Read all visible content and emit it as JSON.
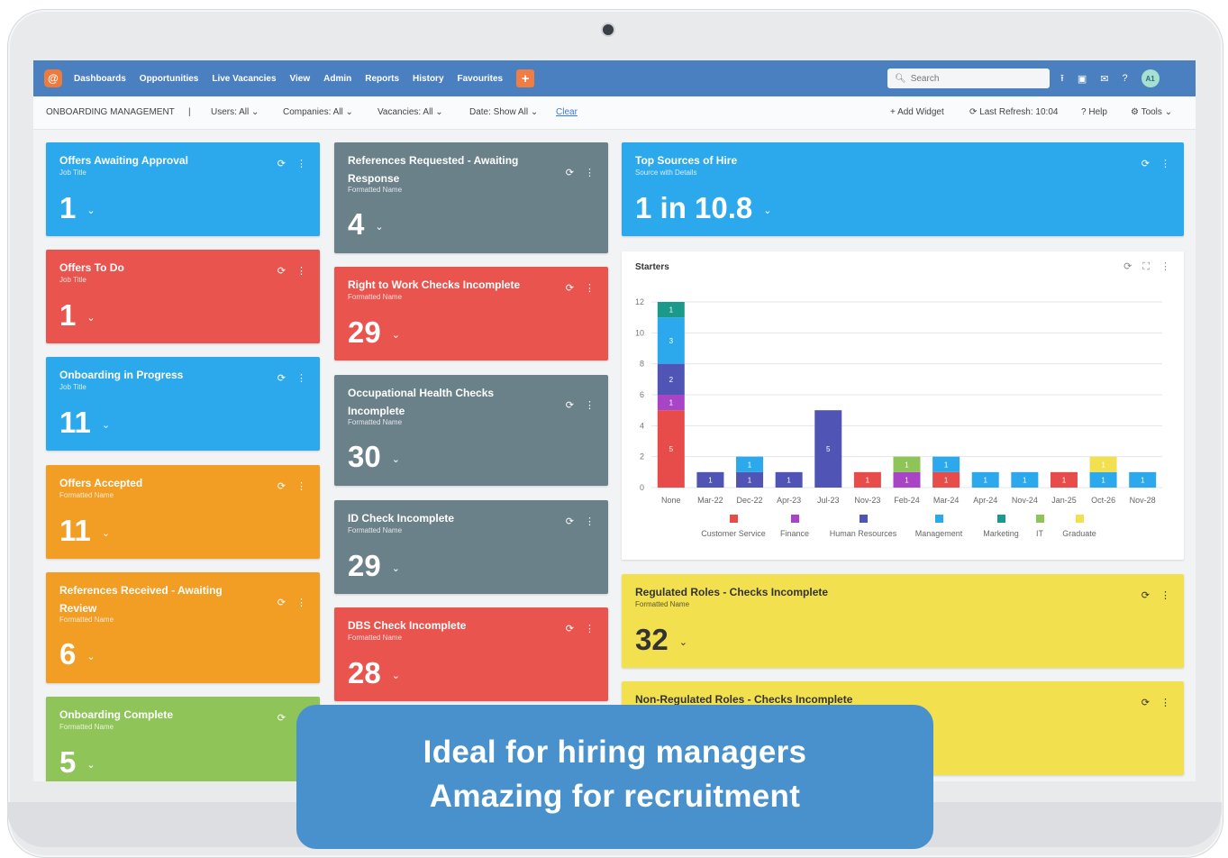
{
  "nav": {
    "logo": "@",
    "items": [
      "Dashboards",
      "Opportunities",
      "Live Vacancies",
      "View",
      "Admin",
      "Reports",
      "History",
      "Favourites"
    ],
    "plus": "+",
    "search_placeholder": "Search",
    "search_icon": "🔍︎",
    "icons": {
      "upload": "⭱",
      "calendar": "▣",
      "mail": "✉",
      "help": "?"
    },
    "avatar": "A1"
  },
  "filters": {
    "section": "ONBOARDING MANAGEMENT",
    "separator": "|",
    "users": "Users: All",
    "companies": "Companies: All",
    "vacancies": "Vacancies: All",
    "date": "Date: Show All",
    "clear": "Clear",
    "add_widget": "Add Widget",
    "last_refresh": "Last Refresh: 10:04",
    "help": "Help",
    "tools": "Tools"
  },
  "tiles": {
    "offers_awaiting": {
      "title": "Offers Awaiting Approval",
      "sub": "Job Title",
      "value": "1"
    },
    "offers_todo": {
      "title": "Offers To Do",
      "sub": "Job Title",
      "value": "1"
    },
    "onboarding_progress": {
      "title": "Onboarding in Progress",
      "sub": "Job Title",
      "value": "11"
    },
    "offers_accepted": {
      "title": "Offers Accepted",
      "sub": "Formatted Name",
      "value": "11"
    },
    "references_received_1": "References Received - Awaiting",
    "references_received_2": "Review",
    "references_received_sub": "Formatted Name",
    "references_received_value": "6",
    "onboarding_complete": {
      "title": "Onboarding Complete",
      "sub": "Formatted Name",
      "value": "5"
    },
    "references_requested_1": "References Requested - Awaiting",
    "references_requested_2": "Response",
    "references_requested_sub": "Formatted Name",
    "references_requested_value": "4",
    "right_to_work": {
      "title": "Right to Work Checks Incomplete",
      "sub": "Formatted Name",
      "value": "29"
    },
    "occupational_1": "Occupational Health Checks",
    "occupational_2": "Incomplete",
    "occupational_sub": "Formatted Name",
    "occupational_value": "30",
    "id_check": {
      "title": "ID Check Incomplete",
      "sub": "Formatted Name",
      "value": "29"
    },
    "dbs_check": {
      "title": "DBS Check Incomplete",
      "sub": "Formatted Name",
      "value": "28"
    },
    "top_sources": {
      "title": "Top Sources of Hire",
      "sub": "Source with Details",
      "value": "1 in 10.8"
    },
    "regulated": {
      "title": "Regulated Roles - Checks Incomplete",
      "sub": "Formatted Name",
      "value": "32"
    },
    "non_regulated": {
      "title": "Non-Regulated Roles - Checks Incomplete"
    }
  },
  "tile_icons": {
    "refresh": "⟳",
    "menu": "⋮",
    "caret": "⌄",
    "expand": "⛶"
  },
  "chart_title": "Starters",
  "chart_data": {
    "type": "bar",
    "stacked": true,
    "categories": [
      "None",
      "Mar-22",
      "Dec-22",
      "Apr-23",
      "Jul-23",
      "Nov-23",
      "Feb-24",
      "Mar-24",
      "Apr-24",
      "Nov-24",
      "Jan-25",
      "Oct-26",
      "Nov-28"
    ],
    "ylim": [
      0,
      12
    ],
    "yticks": [
      0,
      2,
      4,
      6,
      8,
      10,
      12
    ],
    "grid": true,
    "legend_position": "bottom",
    "series": [
      {
        "name": "Customer Service",
        "color": "#e84c4a",
        "values": [
          5,
          0,
          0,
          0,
          0,
          1,
          0,
          1,
          0,
          0,
          1,
          0,
          0
        ]
      },
      {
        "name": "Finance",
        "color": "#a845c7",
        "values": [
          1,
          0,
          0,
          0,
          0,
          0,
          1,
          0,
          0,
          0,
          0,
          0,
          0
        ]
      },
      {
        "name": "Human Resources",
        "color": "#5055b5",
        "values": [
          2,
          1,
          1,
          1,
          5,
          0,
          0,
          0,
          0,
          0,
          0,
          0,
          0
        ]
      },
      {
        "name": "Management",
        "color": "#2ba9ec",
        "values": [
          3,
          0,
          1,
          0,
          0,
          0,
          0,
          1,
          1,
          1,
          0,
          1,
          1
        ]
      },
      {
        "name": "Marketing",
        "color": "#1b9a8c",
        "values": [
          1,
          0,
          0,
          0,
          0,
          0,
          0,
          0,
          0,
          0,
          0,
          0,
          0
        ]
      },
      {
        "name": "IT",
        "color": "#8fc458",
        "values": [
          0,
          0,
          0,
          0,
          0,
          0,
          1,
          0,
          0,
          0,
          0,
          0,
          0
        ]
      },
      {
        "name": "Graduate",
        "color": "#f2e04e",
        "values": [
          0,
          0,
          0,
          0,
          0,
          0,
          0,
          0,
          0,
          0,
          0,
          1,
          0
        ]
      }
    ]
  },
  "banner": {
    "line1": "Ideal for hiring managers",
    "line2": "Amazing for recruitment"
  }
}
